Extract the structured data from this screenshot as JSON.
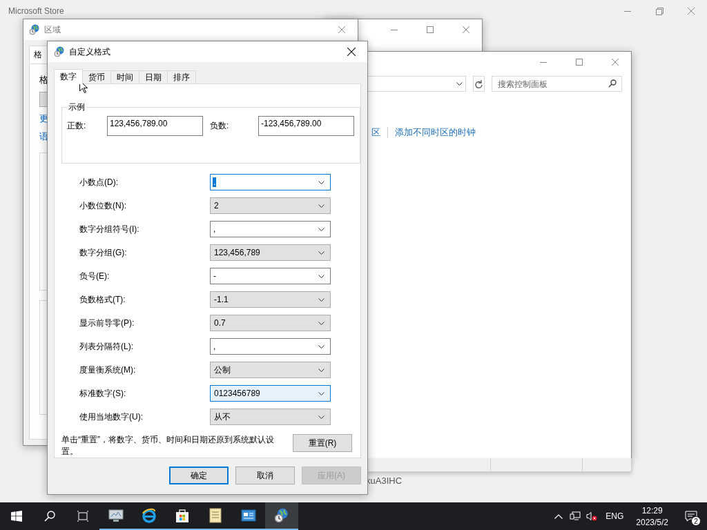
{
  "store_window": {
    "title": "Microsoft Store"
  },
  "region_window": {
    "title": "区域",
    "tab": "格",
    "fragments": [
      "格",
      "更",
      "语"
    ]
  },
  "control_panel": {
    "search": {
      "placeholder": "搜索控制面板"
    },
    "links": [
      "区",
      "添加不同时区的时钟"
    ]
  },
  "desktop_text": "kuA3IHC",
  "dialog": {
    "title": "自定义格式",
    "tabs": [
      {
        "label": "数字",
        "selected": true
      },
      {
        "label": "货币",
        "selected": false
      },
      {
        "label": "时间",
        "selected": false
      },
      {
        "label": "日期",
        "selected": false
      },
      {
        "label": "排序",
        "selected": false
      }
    ],
    "sample": {
      "title": "示例",
      "positive_label": "正数:",
      "positive_value": "123,456,789.00",
      "negative_label": "负数:",
      "negative_value": "-123,456,789.00"
    },
    "settings": [
      {
        "label": "小数点(D):",
        "value": ".",
        "kind": "editable",
        "focused": true
      },
      {
        "label": "小数位数(N):",
        "value": "2",
        "kind": "list",
        "focused": false
      },
      {
        "label": "数字分组符号(I):",
        "value": ",",
        "kind": "editable",
        "focused": false
      },
      {
        "label": "数字分组(G):",
        "value": "123,456,789",
        "kind": "list",
        "focused": false
      },
      {
        "label": "负号(E):",
        "value": "-",
        "kind": "editable",
        "focused": false
      },
      {
        "label": "负数格式(T):",
        "value": "-1.1",
        "kind": "list",
        "focused": false
      },
      {
        "label": "显示前导零(P):",
        "value": "0.7",
        "kind": "list",
        "focused": false
      },
      {
        "label": "列表分隔符(L):",
        "value": ",",
        "kind": "editable",
        "focused": false
      },
      {
        "label": "度量衡系统(M):",
        "value": "公制",
        "kind": "list",
        "focused": false
      },
      {
        "label": "标准数字(S):",
        "value": "0123456789",
        "kind": "list",
        "focused": true
      },
      {
        "label": "使用当地数字(U):",
        "value": "从不",
        "kind": "list",
        "focused": false
      }
    ],
    "note": "单击“重置”，将数字、货币、时间和日期还原到系统默认设置。",
    "reset": "重置(R)",
    "buttons": [
      {
        "label": "确定",
        "kind": "default",
        "disabled": false
      },
      {
        "label": "取消",
        "kind": "normal",
        "disabled": false
      },
      {
        "label": "应用(A)",
        "kind": "normal",
        "disabled": true
      }
    ]
  },
  "taskbar": {
    "apps": [
      {
        "kind": "monitor",
        "selected": false
      },
      {
        "kind": "browser",
        "selected": false
      },
      {
        "kind": "store",
        "selected": false
      },
      {
        "kind": "notepad",
        "selected": false
      },
      {
        "kind": "panel",
        "selected": false
      },
      {
        "kind": "globe",
        "selected": true
      }
    ],
    "language": "ENG",
    "time": "12:29",
    "date": "2023/5/2",
    "notifications": "2"
  }
}
